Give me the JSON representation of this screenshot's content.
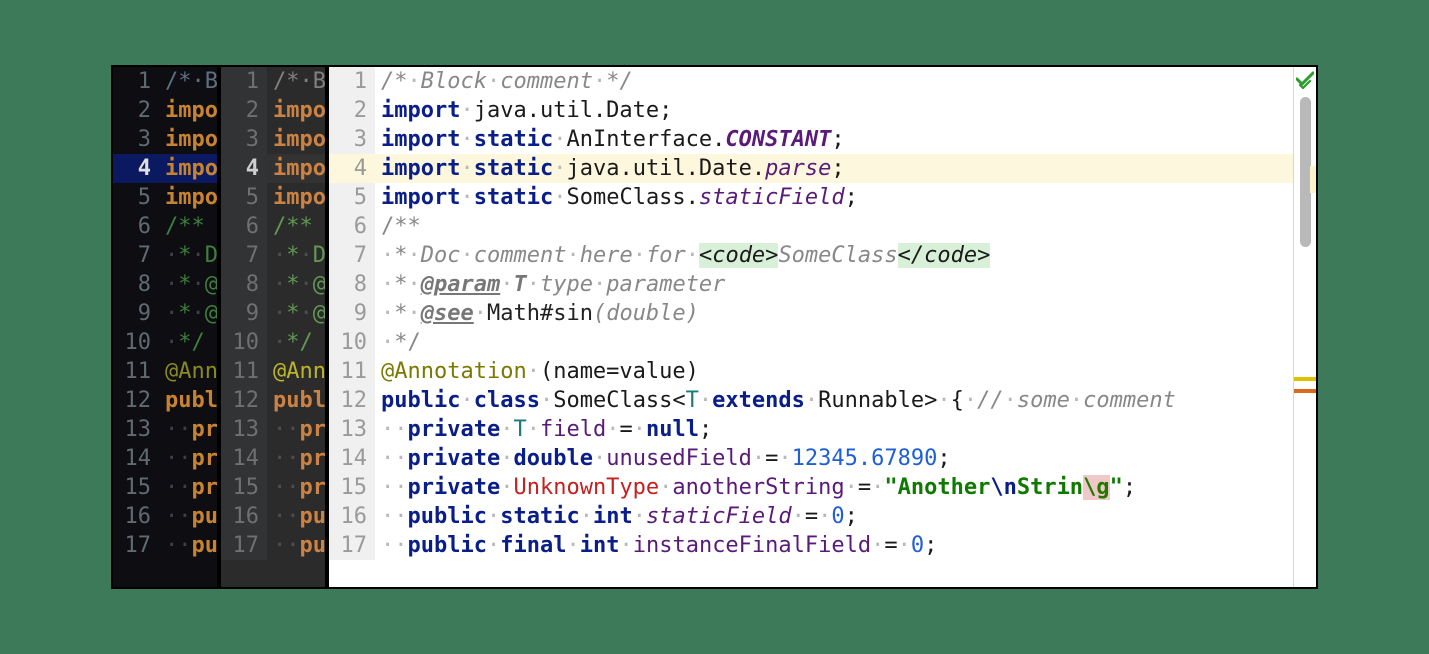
{
  "colors": {
    "page_bg": "#3d7a5a",
    "panel1_bg": "#0d0d12",
    "panel2_bg": "#2b2b2b",
    "panel3_bg": "#ffffff",
    "keyword_light": "#0a1e8a",
    "string_light": "#0f7a00",
    "number_light": "#1e5fd6",
    "field_light": "#5a1a7a",
    "error_light": "#c52020"
  },
  "highlighted_line": 4,
  "gutter_markers": [
    {
      "kind": "warning",
      "color": "#e0c000"
    },
    {
      "kind": "error",
      "color": "#d96b1a"
    }
  ],
  "lines": [
    {
      "n": 1,
      "short": [
        {
          "t": "/*·B",
          "c": "cm"
        }
      ],
      "full": [
        {
          "t": "/*",
          "c": "cm"
        },
        {
          "t": "·",
          "c": "dot"
        },
        {
          "t": "Block",
          "c": "cm"
        },
        {
          "t": "·",
          "c": "dot"
        },
        {
          "t": "comment",
          "c": "cm"
        },
        {
          "t": "·",
          "c": "dot"
        },
        {
          "t": "*/",
          "c": "cm"
        }
      ]
    },
    {
      "n": 2,
      "short": [
        {
          "t": "impo",
          "c": "k"
        }
      ],
      "full": [
        {
          "t": "import",
          "c": "k"
        },
        {
          "t": "·",
          "c": "dot"
        },
        {
          "t": "java.util.Date;",
          "c": ""
        }
      ]
    },
    {
      "n": 3,
      "short": [
        {
          "t": "impo",
          "c": "k"
        }
      ],
      "full": [
        {
          "t": "import",
          "c": "k"
        },
        {
          "t": "·",
          "c": "dot"
        },
        {
          "t": "static",
          "c": "k"
        },
        {
          "t": "·",
          "c": "dot"
        },
        {
          "t": "AnInterface.",
          "c": ""
        },
        {
          "t": "CONSTANT",
          "c": "con"
        },
        {
          "t": ";",
          "c": ""
        }
      ]
    },
    {
      "n": 4,
      "short": [
        {
          "t": "impo",
          "c": "k"
        }
      ],
      "full": [
        {
          "t": "import",
          "c": "k"
        },
        {
          "t": "·",
          "c": "dot"
        },
        {
          "t": "static",
          "c": "k"
        },
        {
          "t": "·",
          "c": "dot"
        },
        {
          "t": "java.util.Date.",
          "c": ""
        },
        {
          "t": "parse",
          "c": "sfld"
        },
        {
          "t": ";",
          "c": ""
        }
      ]
    },
    {
      "n": 5,
      "short": [
        {
          "t": "impo",
          "c": "k"
        }
      ],
      "full": [
        {
          "t": "import",
          "c": "k"
        },
        {
          "t": "·",
          "c": "dot"
        },
        {
          "t": "static",
          "c": "k"
        },
        {
          "t": "·",
          "c": "dot"
        },
        {
          "t": "SomeClass.",
          "c": ""
        },
        {
          "t": "staticField",
          "c": "sfld"
        },
        {
          "t": ";",
          "c": ""
        }
      ]
    },
    {
      "n": 6,
      "short": [
        {
          "t": "/**",
          "c": "doc"
        }
      ],
      "full": [
        {
          "t": "/**",
          "c": "doc"
        }
      ]
    },
    {
      "n": 7,
      "short": [
        {
          "t": "·",
          "c": "dot"
        },
        {
          "t": "*",
          "c": "doc"
        },
        {
          "t": "·",
          "c": "dot"
        },
        {
          "t": "D",
          "c": "doc"
        }
      ],
      "full": [
        {
          "t": "·",
          "c": "dot"
        },
        {
          "t": "*",
          "c": "doc"
        },
        {
          "t": "·",
          "c": "dot"
        },
        {
          "t": "Doc",
          "c": "dm"
        },
        {
          "t": "·",
          "c": "dot"
        },
        {
          "t": "comment",
          "c": "dm"
        },
        {
          "t": "·",
          "c": "dot"
        },
        {
          "t": "here",
          "c": "dm"
        },
        {
          "t": "·",
          "c": "dot"
        },
        {
          "t": "for",
          "c": "dm"
        },
        {
          "t": "·",
          "c": "dot"
        },
        {
          "t": "<code>",
          "c": "tag"
        },
        {
          "t": "SomeClass",
          "c": "dm"
        },
        {
          "t": "</code>",
          "c": "tag"
        }
      ]
    },
    {
      "n": 8,
      "short": [
        {
          "t": "·",
          "c": "dot"
        },
        {
          "t": "*",
          "c": "doc"
        },
        {
          "t": "·",
          "c": "dot"
        },
        {
          "t": "@",
          "c": "doc"
        }
      ],
      "full": [
        {
          "t": "·",
          "c": "dot"
        },
        {
          "t": "*",
          "c": "doc"
        },
        {
          "t": "·",
          "c": "dot"
        },
        {
          "t": "@param",
          "c": "dtag"
        },
        {
          "t": "·",
          "c": "dot"
        },
        {
          "t": "T",
          "c": "dtyp"
        },
        {
          "t": "·",
          "c": "dot"
        },
        {
          "t": "type",
          "c": "dm"
        },
        {
          "t": "·",
          "c": "dot"
        },
        {
          "t": "parameter",
          "c": "dm"
        }
      ]
    },
    {
      "n": 9,
      "short": [
        {
          "t": "·",
          "c": "dot"
        },
        {
          "t": "*",
          "c": "doc"
        },
        {
          "t": "·",
          "c": "dot"
        },
        {
          "t": "@",
          "c": "doc"
        }
      ],
      "full": [
        {
          "t": "·",
          "c": "dot"
        },
        {
          "t": "*",
          "c": "doc"
        },
        {
          "t": "·",
          "c": "dot"
        },
        {
          "t": "@see",
          "c": "dtag"
        },
        {
          "t": "·",
          "c": "dot"
        },
        {
          "t": "Math#sin",
          "c": "lnk"
        },
        {
          "t": "(double)",
          "c": "dm"
        }
      ]
    },
    {
      "n": 10,
      "short": [
        {
          "t": "·",
          "c": "dot"
        },
        {
          "t": "*/",
          "c": "doc"
        }
      ],
      "full": [
        {
          "t": "·",
          "c": "dot"
        },
        {
          "t": "*/",
          "c": "doc"
        }
      ]
    },
    {
      "n": 11,
      "short": [
        {
          "t": "@Ann",
          "c": "ann"
        }
      ],
      "full": [
        {
          "t": "@Annotation",
          "c": "ann"
        },
        {
          "t": "·",
          "c": "dot"
        },
        {
          "t": "(name=value)",
          "c": ""
        }
      ]
    },
    {
      "n": 12,
      "short": [
        {
          "t": "publ",
          "c": "k"
        }
      ],
      "full": [
        {
          "t": "public",
          "c": "k"
        },
        {
          "t": "·",
          "c": "dot"
        },
        {
          "t": "class",
          "c": "k"
        },
        {
          "t": "·",
          "c": "dot"
        },
        {
          "t": "SomeClass<",
          "c": ""
        },
        {
          "t": "T",
          "c": "gen"
        },
        {
          "t": "·",
          "c": "dot"
        },
        {
          "t": "extends",
          "c": "k"
        },
        {
          "t": "·",
          "c": "dot"
        },
        {
          "t": "Runnable>",
          "c": ""
        },
        {
          "t": "·",
          "c": "dot"
        },
        {
          "t": "{",
          "c": ""
        },
        {
          "t": "·",
          "c": "dot"
        },
        {
          "t": "//",
          "c": "cm2"
        },
        {
          "t": "·",
          "c": "dot"
        },
        {
          "t": "some",
          "c": "cm2"
        },
        {
          "t": "·",
          "c": "dot"
        },
        {
          "t": "comment",
          "c": "cm2"
        }
      ]
    },
    {
      "n": 13,
      "short": [
        {
          "t": "··",
          "c": "dot"
        },
        {
          "t": "pr",
          "c": "k"
        }
      ],
      "full": [
        {
          "t": "··",
          "c": "dot"
        },
        {
          "t": "private",
          "c": "k"
        },
        {
          "t": "·",
          "c": "dot"
        },
        {
          "t": "T",
          "c": "gen"
        },
        {
          "t": "·",
          "c": "dot"
        },
        {
          "t": "field",
          "c": "fld"
        },
        {
          "t": "·",
          "c": "dot"
        },
        {
          "t": "=",
          "c": ""
        },
        {
          "t": "·",
          "c": "dot"
        },
        {
          "t": "null",
          "c": "k"
        },
        {
          "t": ";",
          "c": ""
        }
      ]
    },
    {
      "n": 14,
      "short": [
        {
          "t": "··",
          "c": "dot"
        },
        {
          "t": "pr",
          "c": "k"
        }
      ],
      "full": [
        {
          "t": "··",
          "c": "dot"
        },
        {
          "t": "private",
          "c": "k"
        },
        {
          "t": "·",
          "c": "dot"
        },
        {
          "t": "double",
          "c": "k"
        },
        {
          "t": "·",
          "c": "dot"
        },
        {
          "t": "unusedField",
          "c": "fld"
        },
        {
          "t": "·",
          "c": "dot"
        },
        {
          "t": "=",
          "c": ""
        },
        {
          "t": "·",
          "c": "dot"
        },
        {
          "t": "12345.67890",
          "c": "num"
        },
        {
          "t": ";",
          "c": ""
        }
      ]
    },
    {
      "n": 15,
      "short": [
        {
          "t": "··",
          "c": "dot"
        },
        {
          "t": "pr",
          "c": "k"
        }
      ],
      "full": [
        {
          "t": "··",
          "c": "dot"
        },
        {
          "t": "private",
          "c": "k"
        },
        {
          "t": "·",
          "c": "dot"
        },
        {
          "t": "UnknownType",
          "c": "err"
        },
        {
          "t": "·",
          "c": "dot"
        },
        {
          "t": "anotherString",
          "c": "fld"
        },
        {
          "t": "·",
          "c": "dot"
        },
        {
          "t": "=",
          "c": ""
        },
        {
          "t": "·",
          "c": "dot"
        },
        {
          "t": "\"Another",
          "c": "str"
        },
        {
          "t": "\\n",
          "c": "esc"
        },
        {
          "t": "Strin",
          "c": "str"
        },
        {
          "t": "\\g",
          "c": "bad"
        },
        {
          "t": "\"",
          "c": "str"
        },
        {
          "t": ";",
          "c": ""
        }
      ]
    },
    {
      "n": 16,
      "short": [
        {
          "t": "··",
          "c": "dot"
        },
        {
          "t": "pu",
          "c": "k"
        }
      ],
      "full": [
        {
          "t": "··",
          "c": "dot"
        },
        {
          "t": "public",
          "c": "k"
        },
        {
          "t": "·",
          "c": "dot"
        },
        {
          "t": "static",
          "c": "k"
        },
        {
          "t": "·",
          "c": "dot"
        },
        {
          "t": "int",
          "c": "k"
        },
        {
          "t": "·",
          "c": "dot"
        },
        {
          "t": "staticField",
          "c": "sfld"
        },
        {
          "t": "·",
          "c": "dot"
        },
        {
          "t": "=",
          "c": ""
        },
        {
          "t": "·",
          "c": "dot"
        },
        {
          "t": "0",
          "c": "num"
        },
        {
          "t": ";",
          "c": ""
        }
      ]
    },
    {
      "n": 17,
      "short": [
        {
          "t": "··",
          "c": "dot"
        },
        {
          "t": "pu",
          "c": "k"
        }
      ],
      "full": [
        {
          "t": "··",
          "c": "dot"
        },
        {
          "t": "public",
          "c": "k"
        },
        {
          "t": "·",
          "c": "dot"
        },
        {
          "t": "final",
          "c": "k"
        },
        {
          "t": "·",
          "c": "dot"
        },
        {
          "t": "int",
          "c": "k"
        },
        {
          "t": "·",
          "c": "dot"
        },
        {
          "t": "instanceFinalField",
          "c": "fld"
        },
        {
          "t": "·",
          "c": "dot"
        },
        {
          "t": "=",
          "c": ""
        },
        {
          "t": "·",
          "c": "dot"
        },
        {
          "t": "0",
          "c": "num"
        },
        {
          "t": ";",
          "c": ""
        }
      ]
    }
  ]
}
